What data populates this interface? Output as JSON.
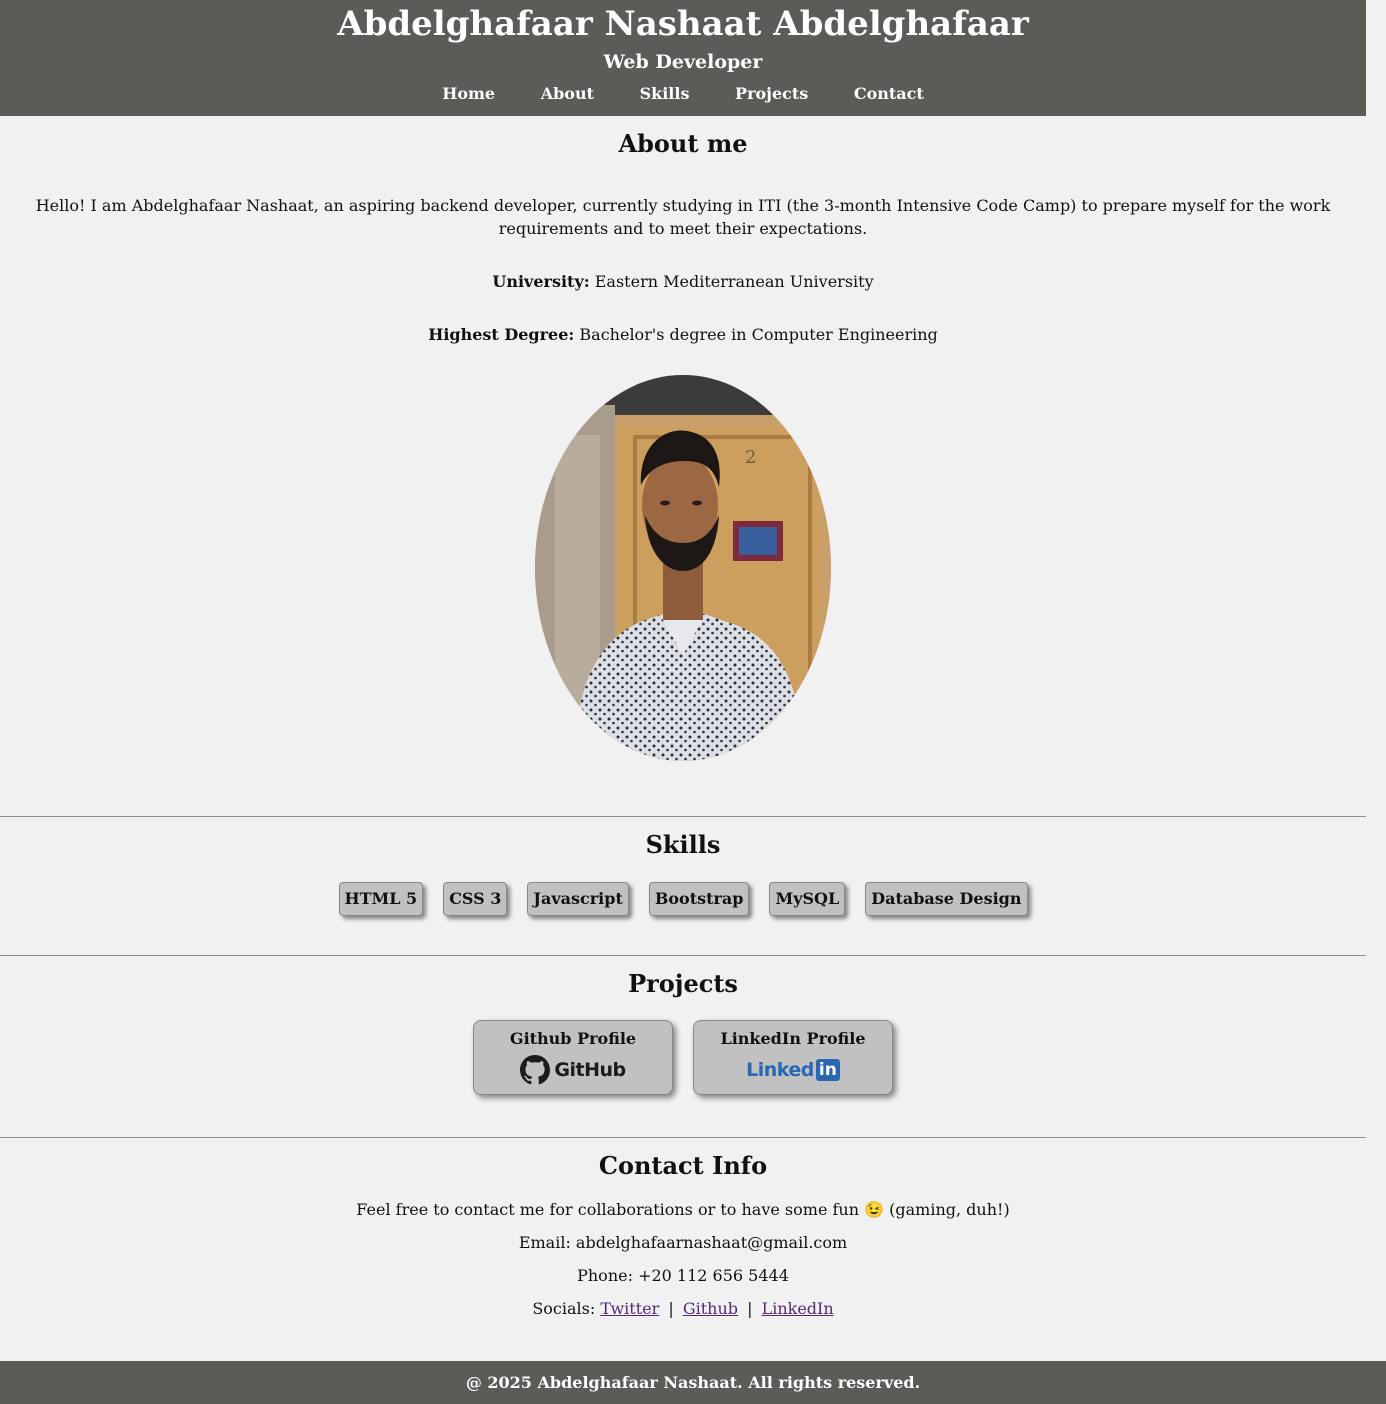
{
  "header": {
    "title": "Abdelghafaar Nashaat Abdelghafaar",
    "subtitle": "Web Developer",
    "nav": [
      "Home",
      "About",
      "Skills",
      "Projects",
      "Contact"
    ]
  },
  "about": {
    "heading": "About me",
    "intro": "Hello! I am Abdelghafaar Nashaat, an aspiring backend developer, currently studying in ITI (the 3-month Intensive Code Camp) to prepare myself for the work requirements and to meet their expectations.",
    "university_label": "University:",
    "university_value": "Eastern Mediterranean University",
    "degree_label": "Highest Degree:",
    "degree_value": "Bachelor's degree in Computer Engineering",
    "door_number": "2"
  },
  "skills": {
    "heading": "Skills",
    "items": [
      "HTML 5",
      "CSS 3",
      "Javascript",
      "Bootstrap",
      "MySQL",
      "Database Design"
    ]
  },
  "projects": {
    "heading": "Projects",
    "items": [
      {
        "title": "Github Profile",
        "logo_text": "GitHub",
        "icon": "github-octocat-icon"
      },
      {
        "title": "LinkedIn Profile",
        "logo_text": "Linked",
        "logo_box": "in",
        "icon": "linkedin-icon"
      }
    ]
  },
  "contact": {
    "heading": "Contact Info",
    "intro": "Feel free to contact me for collaborations or to have some fun 😉 (gaming, duh!)",
    "email": "Email: abdelghafaarnashaat@gmail.com",
    "phone": "Phone: +20 112 656 5444",
    "socials_label": "Socials:",
    "socials": [
      "Twitter",
      "Github",
      "LinkedIn"
    ],
    "separator": "|"
  },
  "footer": {
    "text": "@ 2025 Abdelghafaar Nashaat. All rights reserved."
  },
  "colors": {
    "header_bg": "#5c5b57",
    "page_bg": "#f1f1f1",
    "card_bg": "#c1c1c1",
    "link": "#56287c",
    "linkedin_blue": "#2a67b2"
  }
}
